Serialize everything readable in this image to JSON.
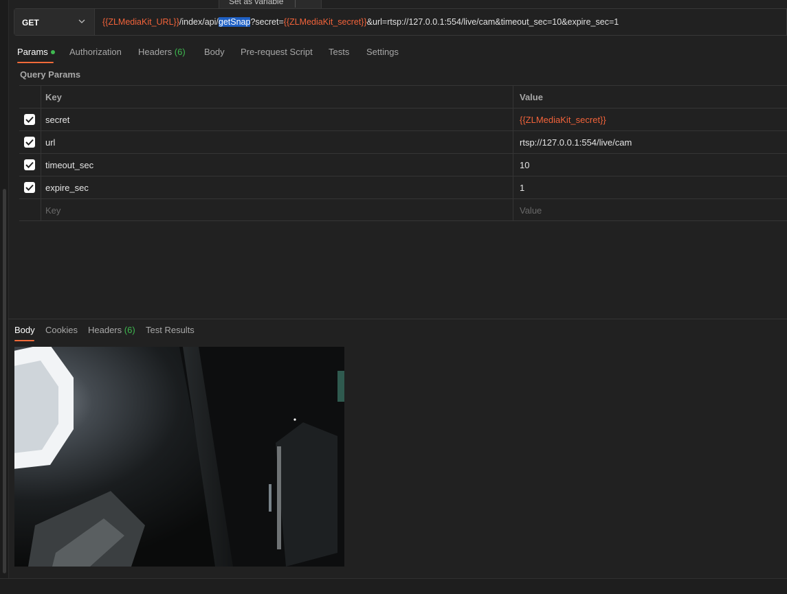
{
  "tooltip": {
    "text": "Set as variable"
  },
  "request": {
    "method": "GET",
    "url": {
      "part1_var": "{{ZLMediaKit_URL}}",
      "part2": "/index/api/",
      "part3_selected": "getSnap",
      "part4": "?secret=",
      "part5_var": "{{ZLMediaKit_secret}}",
      "part6": "&url=rtsp://127.0.0.1:554/live/cam&timeout_sec=10&expire_sec=1"
    }
  },
  "request_tabs": [
    {
      "label": "Params",
      "count": ""
    },
    {
      "label": "Authorization",
      "count": ""
    },
    {
      "label": "Headers",
      "count": "(6)"
    },
    {
      "label": "Body",
      "count": ""
    },
    {
      "label": "Pre-request Script",
      "count": ""
    },
    {
      "label": "Tests",
      "count": ""
    },
    {
      "label": "Settings",
      "count": ""
    }
  ],
  "query_params": {
    "title": "Query Params",
    "key_header": "Key",
    "value_header": "Value",
    "rows": [
      {
        "key": "secret",
        "value": "{{ZLMediaKit_secret}}",
        "checked": true
      },
      {
        "key": "url",
        "value": "rtsp://127.0.0.1:554/live/cam",
        "checked": true
      },
      {
        "key": "timeout_sec",
        "value": "10",
        "checked": true
      },
      {
        "key": "expire_sec",
        "value": "1",
        "checked": true
      }
    ],
    "key_placeholder": "Key",
    "value_placeholder": "Value"
  },
  "response_tabs": [
    {
      "label": "Body",
      "count": ""
    },
    {
      "label": "Cookies",
      "count": ""
    },
    {
      "label": "Headers",
      "count": "(6)"
    },
    {
      "label": "Test Results",
      "count": ""
    }
  ],
  "colors": {
    "accent": "#f26b3a",
    "variable": "#f2633a",
    "success": "#3fb950",
    "selection": "#1f60c4",
    "background": "#212121"
  }
}
